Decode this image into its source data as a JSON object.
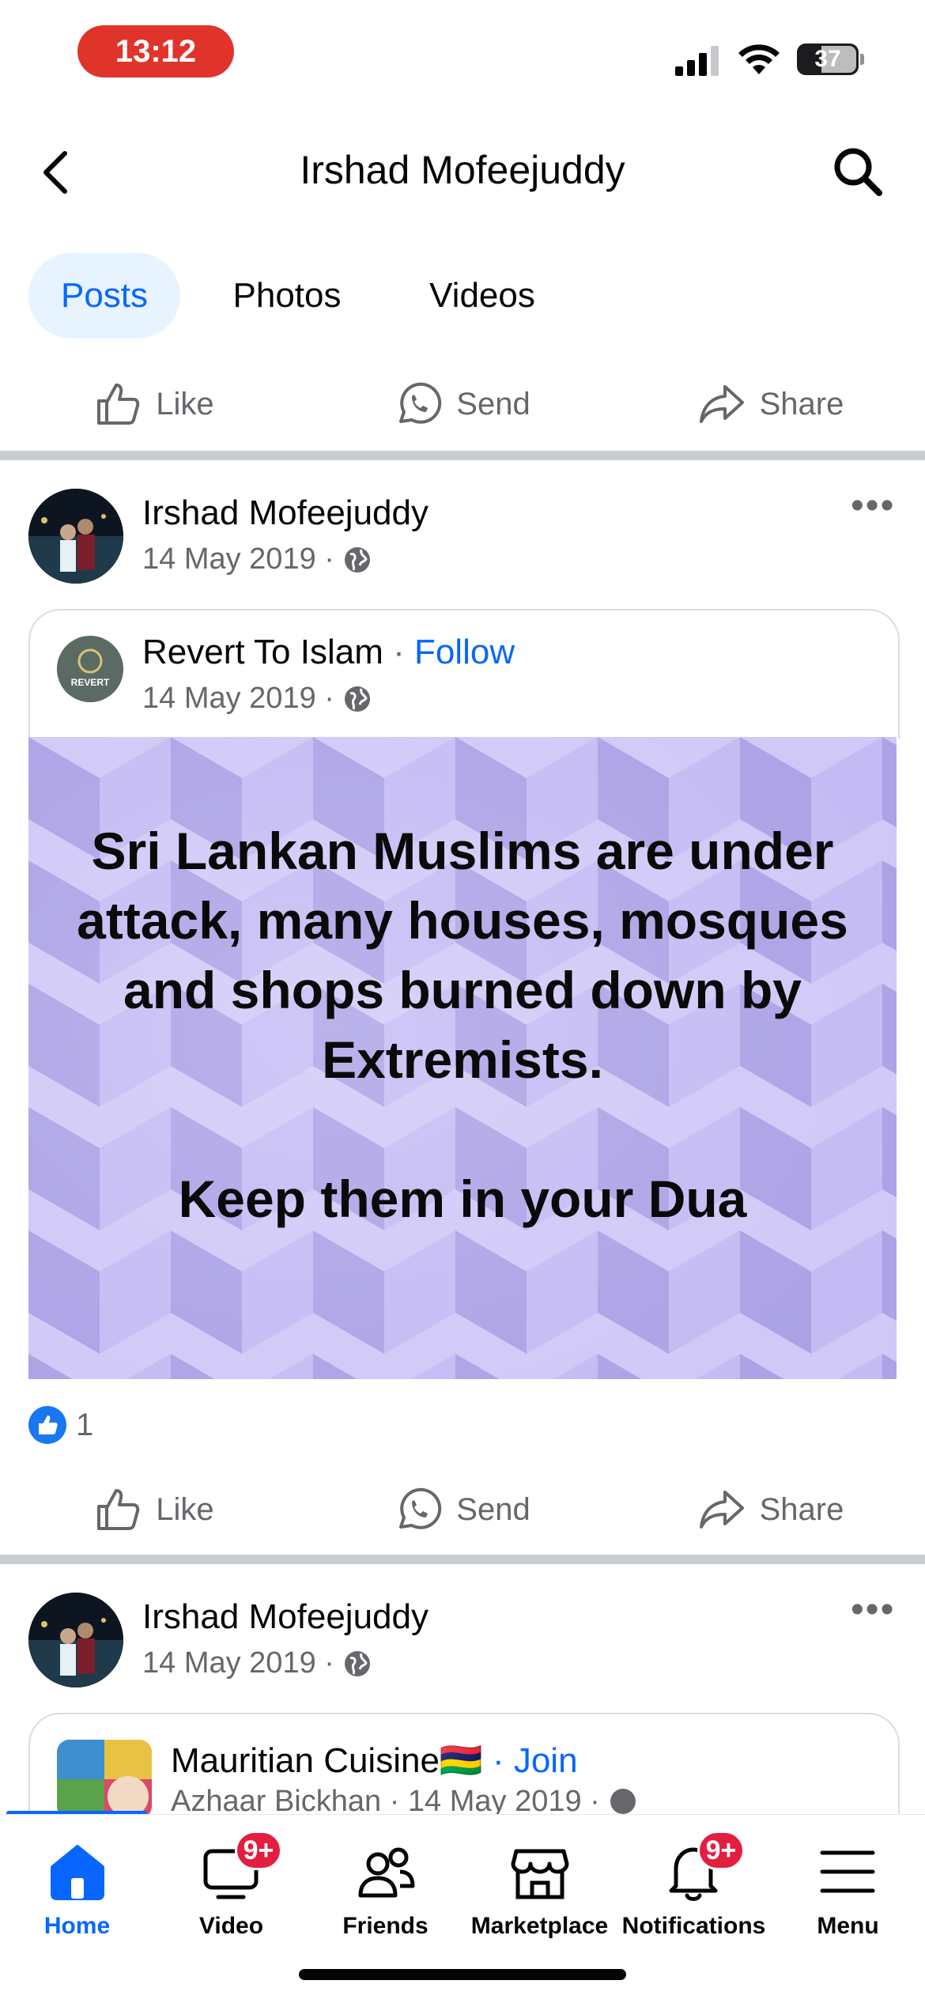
{
  "status_bar": {
    "time": "13:12",
    "battery": "37"
  },
  "header": {
    "title": "Irshad Mofeejuddy"
  },
  "tabs": [
    {
      "label": "Posts",
      "active": true
    },
    {
      "label": "Photos",
      "active": false
    },
    {
      "label": "Videos",
      "active": false
    }
  ],
  "actions": {
    "like": "Like",
    "send": "Send",
    "share": "Share"
  },
  "post1": {
    "author": "Irshad Mofeejuddy",
    "date": "14 May 2019 ·",
    "shared": {
      "page_name": "Revert To Islam",
      "separator": " · ",
      "follow_label": "Follow",
      "date": "14 May 2019 ·",
      "avatar_text": "REVERT"
    },
    "image_text": "Sri Lankan Muslims are under attack, many houses, mosques and shops burned down by Extremists.\n\nKeep them in your Dua",
    "reaction_count": "1"
  },
  "post2": {
    "author": "Irshad Mofeejuddy",
    "date": "14 May 2019 ·",
    "shared": {
      "group_name": "Mauritian Cuisine🇲🇺",
      "join_label": "· Join",
      "subline": "Azhaar Bickhan · 14 May 2019 ·"
    }
  },
  "bottom_nav": [
    {
      "label": "Home",
      "active": true
    },
    {
      "label": "Video",
      "badge": "9+"
    },
    {
      "label": "Friends"
    },
    {
      "label": "Marketplace"
    },
    {
      "label": "Notifications",
      "badge": "9+"
    },
    {
      "label": "Menu"
    }
  ],
  "colors": {
    "accent": "#0866ff",
    "badge": "#e41e3f",
    "image_bg": "#b8aef0",
    "time_pill": "#e0342b"
  }
}
